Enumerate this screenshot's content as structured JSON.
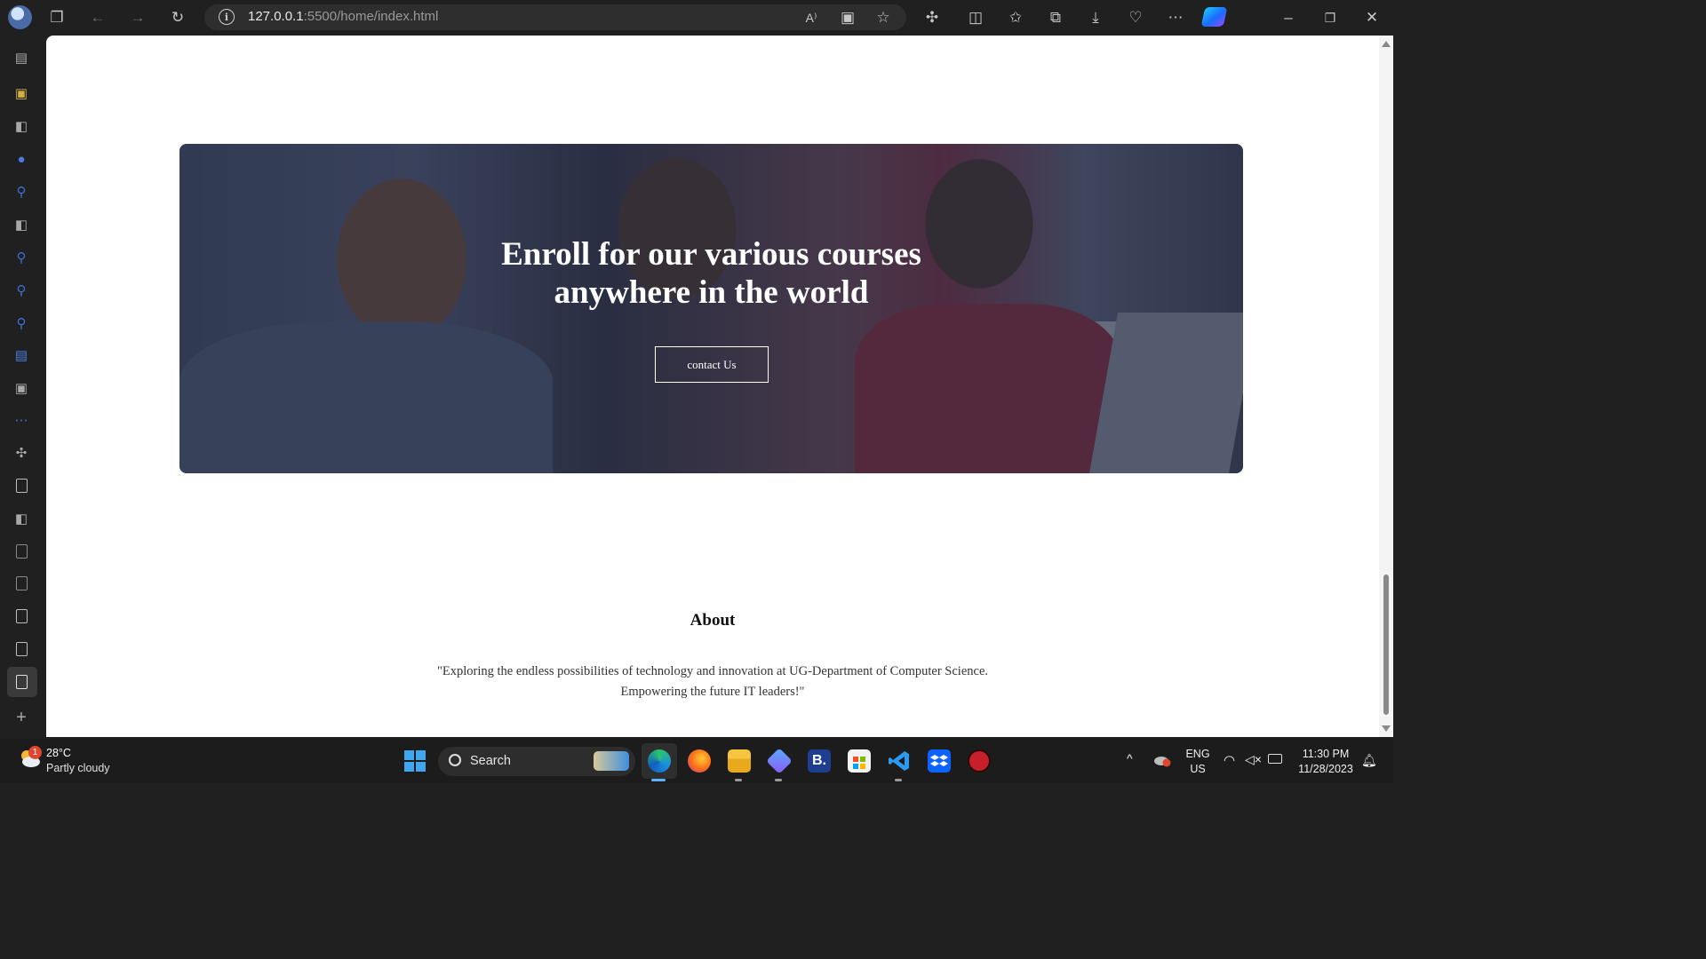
{
  "browser": {
    "url_host": "127.0.0.1",
    "url_rest": ":5500/home/index.html"
  },
  "page": {
    "hero": {
      "title_line1": "Enroll for our various courses",
      "title_line2": "anywhere in the world",
      "button_label": "contact Us"
    },
    "about": {
      "title": "About",
      "text_line1": "\"Exploring the endless possibilities of technology and innovation at UG-Department of Computer Science.",
      "text_line2": "Empowering the future IT leaders!\""
    }
  },
  "taskbar": {
    "weather_temp": "28°C",
    "weather_desc": "Partly cloudy",
    "weather_badge": "1",
    "search_label": "Search",
    "language": "ENG",
    "region": "US",
    "time": "11:30 PM",
    "date": "11/28/2023",
    "apps": [
      "windows-start",
      "edge",
      "firefox",
      "file-explorer",
      "copilot-app",
      "booking",
      "microsoft-store",
      "vscode",
      "dropbox",
      "security-app"
    ]
  },
  "colors": {
    "browser_chrome": "#202020",
    "taskbar": "#1c1c1c",
    "page_bg": "#ffffff",
    "hero_overlay": "#2c3350"
  }
}
